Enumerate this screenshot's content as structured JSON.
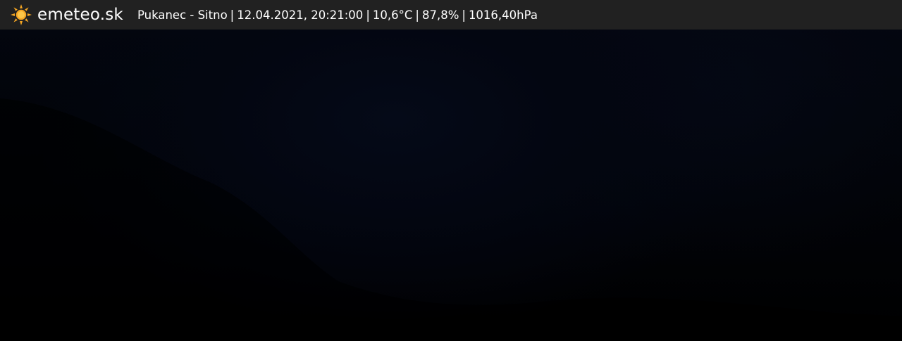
{
  "brand": {
    "name": "emeteo.sk",
    "icon": "sun-icon",
    "icon_color": "#f5a623"
  },
  "info": {
    "location": "Pukanec - Sitno",
    "separator": "|",
    "datetime": "12.04.2021, 20:21:00",
    "temperature": "10,6°C",
    "humidity": "87,8%",
    "pressure": "1016,40hPa"
  },
  "colors": {
    "bar_background": "#222222",
    "text": "#ffffff",
    "image_background": "#020409"
  }
}
